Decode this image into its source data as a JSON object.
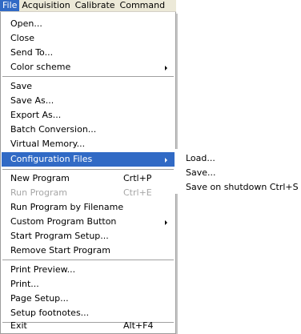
{
  "menubar": {
    "items": [
      {
        "label": "File"
      },
      {
        "label": "Acquisition"
      },
      {
        "label": "Calibrate"
      },
      {
        "label": "Command"
      }
    ]
  },
  "file_menu": {
    "items": [
      {
        "label": "Open..."
      },
      {
        "label": "Close"
      },
      {
        "label": "Send To..."
      },
      {
        "label": "Color scheme"
      },
      {
        "label": "Save"
      },
      {
        "label": "Save As..."
      },
      {
        "label": "Export As..."
      },
      {
        "label": "Batch Conversion..."
      },
      {
        "label": "Virtual Memory..."
      },
      {
        "label": "Configuration Files"
      },
      {
        "label": "New Program",
        "shortcut": "Crtl+P"
      },
      {
        "label": "Run Program",
        "shortcut": "Ctrl+E"
      },
      {
        "label": "Run Program by Filename"
      },
      {
        "label": "Custom Program Button"
      },
      {
        "label": "Start Program Setup..."
      },
      {
        "label": "Remove Start Program"
      },
      {
        "label": "Print Preview..."
      },
      {
        "label": "Print..."
      },
      {
        "label": "Page Setup..."
      },
      {
        "label": "Setup footnotes..."
      },
      {
        "label": "Exit",
        "shortcut": "Alt+F4"
      }
    ]
  },
  "config_submenu": {
    "items": [
      {
        "label": "Load..."
      },
      {
        "label": "Save..."
      },
      {
        "label": "Save on shutdown  Ctrl+S"
      }
    ]
  },
  "colors": {
    "highlight": "#316ac5",
    "disabled_text": "#a6a6a6",
    "menubar_bg": "#ece9d8"
  }
}
